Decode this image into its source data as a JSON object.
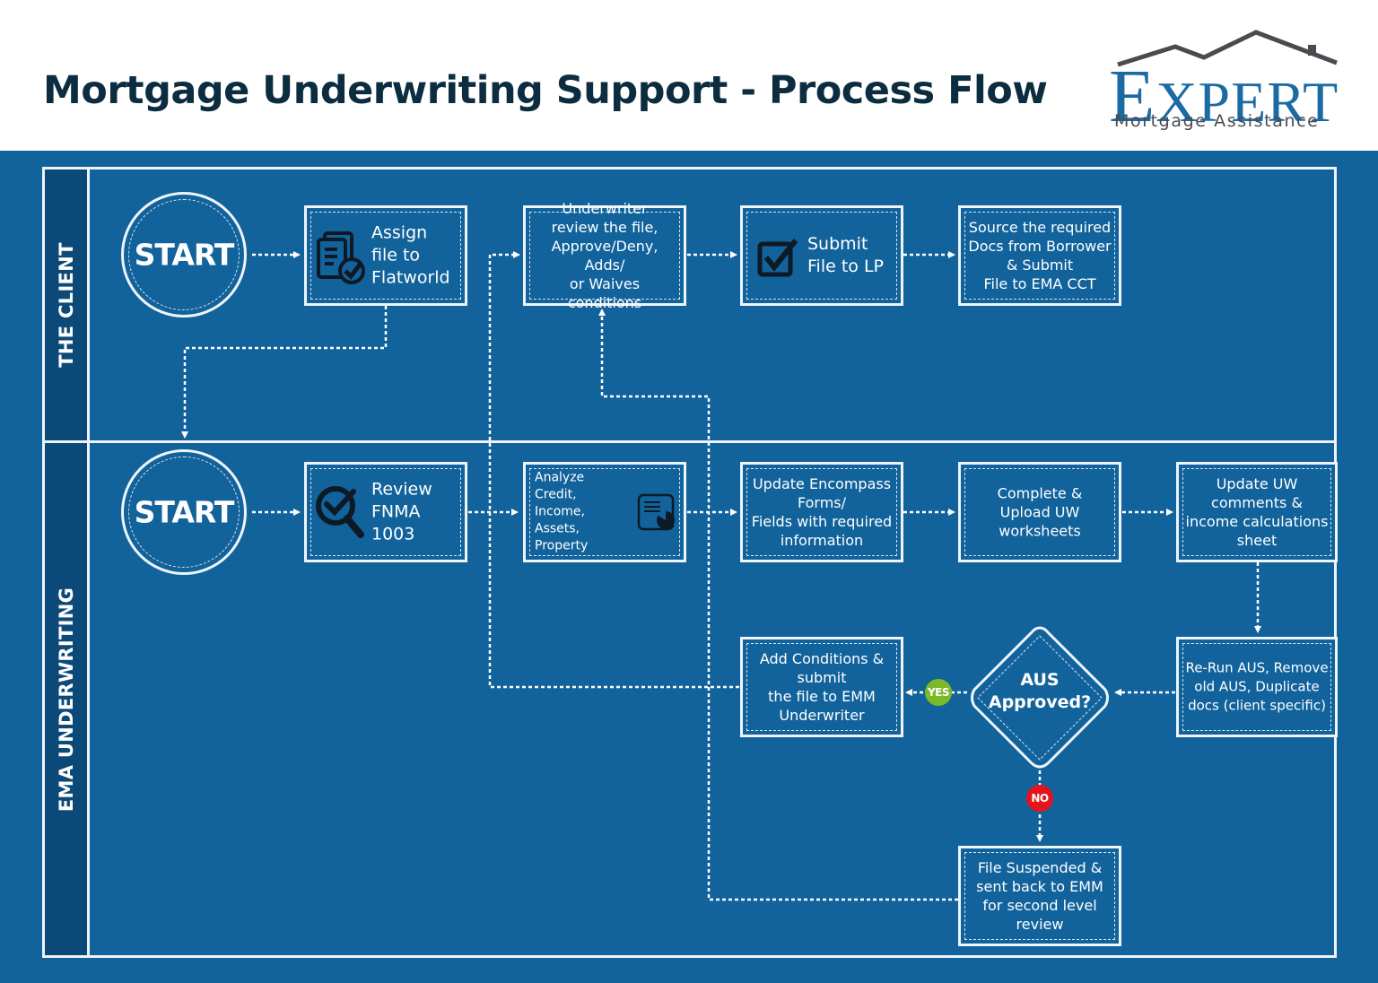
{
  "header": {
    "title": "Mortgage Underwriting Support - Process Flow",
    "logo": {
      "word_initial": "E",
      "word_rest": "XPERT",
      "subtitle": "Mortgage Assistance",
      "icon": "house-roof-icon"
    }
  },
  "colors": {
    "background": "#12639c",
    "lane_label_bg": "#0b4a78",
    "title": "#0c2d40",
    "logo_blue": "#1a6aa3",
    "logo_gray": "#4a4a50",
    "yes": "#7cb928",
    "no": "#e3141c",
    "line": "#eef4f9"
  },
  "lanes": [
    {
      "id": "client",
      "label": "THE CLIENT"
    },
    {
      "id": "ema",
      "label": "EMA UNDERWRITING"
    }
  ],
  "nodes": {
    "client_start": {
      "label": "START",
      "shape": "circle"
    },
    "assign": {
      "label": "Assign file to Flatworld",
      "icon": "document-check-icon"
    },
    "uw_review": {
      "label": "Underwriter review the file, Approve/Deny, Adds/ or Waives conditions"
    },
    "submit_lp": {
      "label": "Submit File to LP",
      "icon": "checkbox-checked-icon"
    },
    "source_docs": {
      "label": "Source the required Docs from Borrower & Submit File to EMA CCT"
    },
    "ema_start": {
      "label": "START",
      "shape": "circle"
    },
    "review_fnma": {
      "label": "Review FNMA 1003",
      "icon": "magnifier-check-icon"
    },
    "analyze": {
      "label": "Analyze Credit, Income, Assets, Property",
      "icon": "report-pie-chart-icon"
    },
    "update_encompass": {
      "label": "Update Encompass Forms/ Fields with required information"
    },
    "complete_upload": {
      "label": "Complete & Upload UW worksheets"
    },
    "update_uw": {
      "label": "Update UW comments & income calculations sheet"
    },
    "rerun_aus": {
      "label": "Re-Run AUS, Remove old AUS, Duplicate docs (client specific)"
    },
    "aus_decision": {
      "label": "AUS Approved?",
      "shape": "diamond"
    },
    "add_conditions": {
      "label": "Add Conditions & submit the file to EMM Underwriter"
    },
    "suspended": {
      "label": "File Suspended & sent back to EMM for second level review"
    }
  },
  "lines": {
    "assign": [
      "Assign",
      "file to",
      "Flatworld"
    ],
    "uw_review": [
      "Underwriter",
      "review the file,",
      "Approve/Deny, Adds/",
      "or Waives conditions"
    ],
    "submit_lp": [
      "Submit",
      "File to LP"
    ],
    "source_docs": [
      "Source the required",
      "Docs from Borrower",
      "& Submit",
      "File to EMA CCT"
    ],
    "review_fnma": [
      "Review",
      "FNMA",
      "1003"
    ],
    "analyze": [
      "Analyze Credit,",
      "Income, Assets,",
      "Property"
    ],
    "update_encompass": [
      "Update Encompass",
      "Forms/",
      "Fields with required",
      "information"
    ],
    "complete_upload": [
      "Complete &",
      "Upload UW",
      "worksheets"
    ],
    "update_uw": [
      "Update UW",
      "comments &",
      "income calculations",
      "sheet"
    ],
    "rerun_aus": [
      "Re-Run AUS, Remove",
      "old AUS, Duplicate",
      "docs (client specific)"
    ],
    "aus_decision": [
      "AUS",
      "Approved?"
    ],
    "add_conditions": [
      "Add Conditions &",
      "submit",
      "the file to EMM",
      "Underwriter"
    ],
    "suspended": [
      "File Suspended &",
      "sent back to EMM",
      "for second level",
      "review"
    ]
  },
  "branches": {
    "yes": "YES",
    "no": "NO"
  },
  "edges": [
    [
      "client_start",
      "assign"
    ],
    [
      "assign",
      "ema_start"
    ],
    [
      "uw_review",
      "submit_lp"
    ],
    [
      "submit_lp",
      "source_docs"
    ],
    [
      "ema_start",
      "review_fnma"
    ],
    [
      "review_fnma",
      "analyze"
    ],
    [
      "analyze",
      "update_encompass"
    ],
    [
      "update_encompass",
      "complete_upload"
    ],
    [
      "complete_upload",
      "update_uw"
    ],
    [
      "update_uw",
      "rerun_aus"
    ],
    [
      "rerun_aus",
      "aus_decision"
    ],
    [
      "aus_decision",
      "add_conditions",
      "YES"
    ],
    [
      "aus_decision",
      "suspended",
      "NO"
    ],
    [
      "add_conditions",
      "uw_review"
    ],
    [
      "suspended",
      "uw_review"
    ]
  ]
}
